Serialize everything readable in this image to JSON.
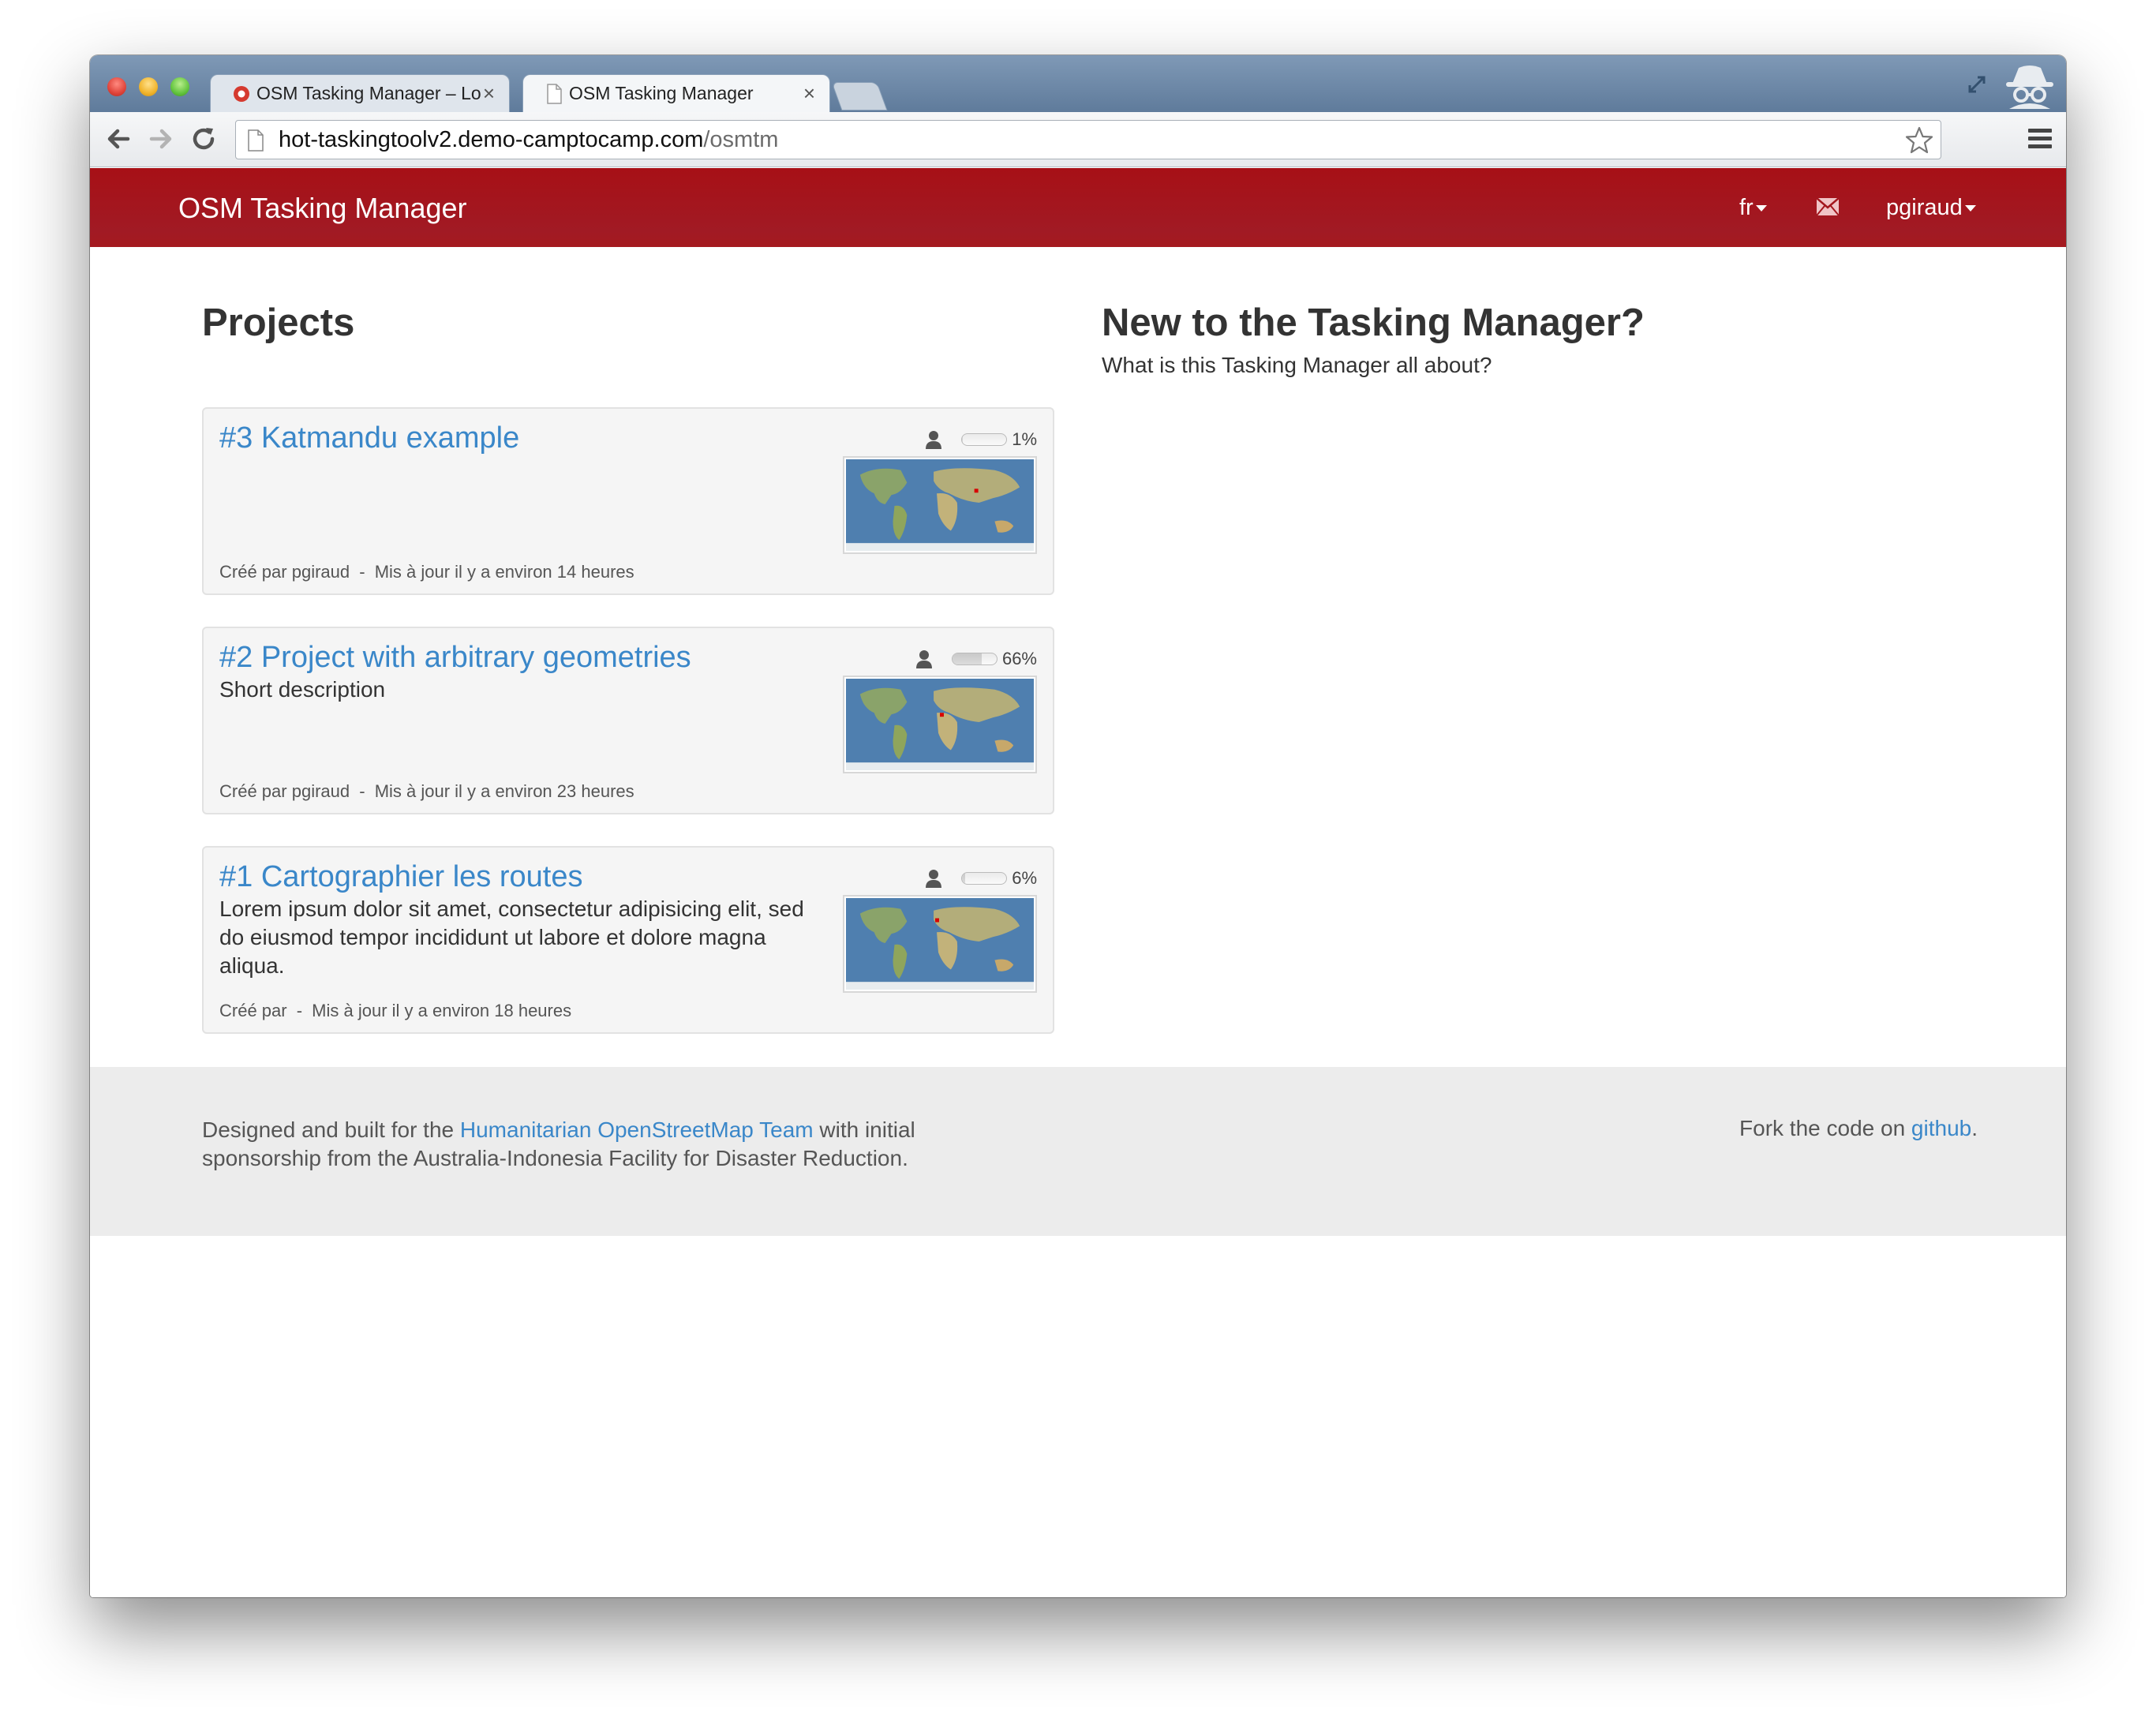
{
  "browser": {
    "tabs": [
      {
        "title": "OSM Tasking Manager – Lo",
        "active": false,
        "icon": "red-gear-favicon"
      },
      {
        "title": "OSM Tasking Manager",
        "active": true,
        "icon": "document-favicon"
      }
    ],
    "tab_close_glyph": "×",
    "url": {
      "host": "hot-taskingtoolv2.demo-camptocamp.com",
      "path": "/osmtm"
    }
  },
  "navbar": {
    "brand": "OSM Tasking Manager",
    "language": "fr",
    "user": "pgiraud",
    "brand_color": "#a3161d"
  },
  "projects_heading": "Projects",
  "projects": [
    {
      "title": "#3 Katmandu example",
      "description": "",
      "created_label": "Créé par",
      "author": "pgiraud",
      "updated": "Mis à jour il y a environ 14 heures",
      "progress": "1%",
      "progress_value": 1
    },
    {
      "title": "#2 Project with arbitrary geometries",
      "description": "Short description",
      "created_label": "Créé par",
      "author": "pgiraud",
      "updated": "Mis à jour il y a environ 23 heures",
      "progress": "66%",
      "progress_value": 66
    },
    {
      "title": "#1 Cartographier les routes",
      "description": "Lorem ipsum dolor sit amet, consectetur adipisicing elit, sed do eiusmod tempor incididunt ut labore et dolore magna aliqua.",
      "created_label": "Créé par",
      "author": "",
      "updated": "Mis à jour il y a environ 18 heures",
      "progress": "6%",
      "progress_value": 6
    }
  ],
  "meta_separator": "-",
  "sidebar": {
    "heading": "New to the Tasking Manager?",
    "link": "What is this Tasking Manager all about?"
  },
  "footer": {
    "text_before": "Designed and built for the",
    "hot_link": "Humanitarian OpenStreetMap Team",
    "text_after": "with initial sponsorship from the Australia-Indonesia Facility for Disaster Reduction.",
    "fork_before": "Fork the code on",
    "github_link": "github",
    "fork_after": ".",
    "link_color": "#3a87c9"
  }
}
